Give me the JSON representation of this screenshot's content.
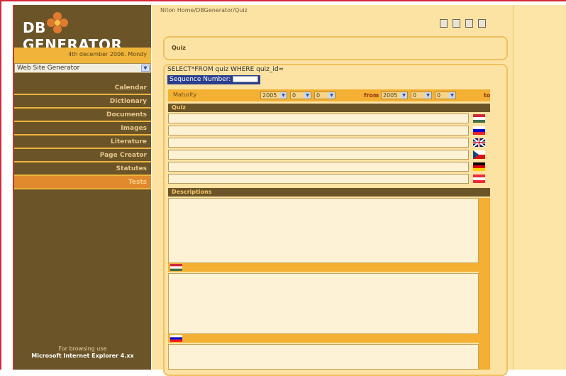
{
  "app": {
    "logo_left": "DB",
    "logo_right": "GENERATOR",
    "date": "4th december 2006. Mondy"
  },
  "site_select": {
    "value": "Web Site Generator"
  },
  "nav": {
    "items": [
      {
        "label": "Calendar"
      },
      {
        "label": "Dictionary"
      },
      {
        "label": "Documents"
      },
      {
        "label": "Images"
      },
      {
        "label": "Literature"
      },
      {
        "label": "Page Creator"
      },
      {
        "label": "Statutes"
      },
      {
        "label": "Tests",
        "active": true
      }
    ]
  },
  "browse_note": {
    "line1": "For browsing use",
    "line2": "Microsoft Internet Explorer 4.xx"
  },
  "breadcrumb": "Niton Home/DBGenerator/Quiz",
  "quiz_panel": {
    "title": "Quiz"
  },
  "sql": "SELECT*FROM quiz WHERE quiz_id=",
  "sequence": {
    "label": "Sequence Number:"
  },
  "maturity": {
    "label": "Maturity",
    "year_from": "2005",
    "month_from": "0",
    "day_from": "0",
    "from_label": "from",
    "year_to": "2005",
    "month_to": "0",
    "day_to": "0",
    "to_label": "to"
  },
  "sections": {
    "quiz": "Quiz",
    "descriptions": "Descriptions"
  },
  "flags": [
    "hungary",
    "slovenia",
    "united-kingdom",
    "czech",
    "germany",
    "austria"
  ],
  "colors": {
    "sidebar": "#6b5528",
    "accent": "#f0b43a",
    "active_nav": "#e08a2d",
    "main_bg": "#fde3a3"
  }
}
